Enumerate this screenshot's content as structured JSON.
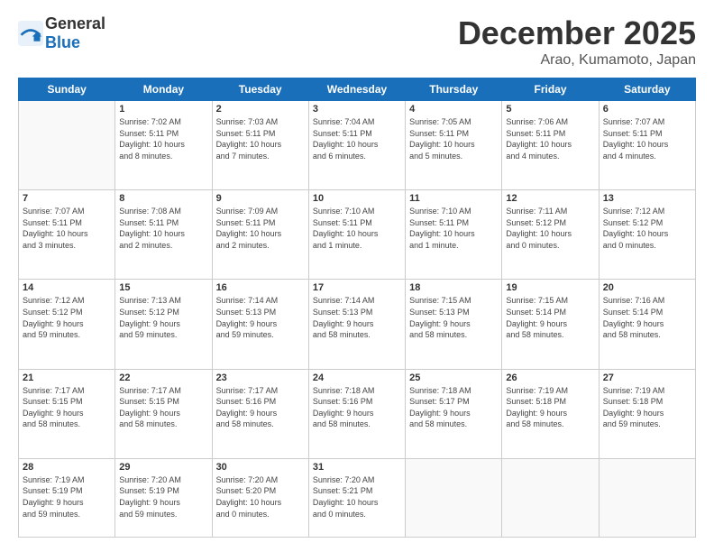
{
  "header": {
    "logo_general": "General",
    "logo_blue": "Blue",
    "month": "December 2025",
    "location": "Arao, Kumamoto, Japan"
  },
  "days_of_week": [
    "Sunday",
    "Monday",
    "Tuesday",
    "Wednesday",
    "Thursday",
    "Friday",
    "Saturday"
  ],
  "weeks": [
    [
      {
        "day": "",
        "info": ""
      },
      {
        "day": "1",
        "info": "Sunrise: 7:02 AM\nSunset: 5:11 PM\nDaylight: 10 hours\nand 8 minutes."
      },
      {
        "day": "2",
        "info": "Sunrise: 7:03 AM\nSunset: 5:11 PM\nDaylight: 10 hours\nand 7 minutes."
      },
      {
        "day": "3",
        "info": "Sunrise: 7:04 AM\nSunset: 5:11 PM\nDaylight: 10 hours\nand 6 minutes."
      },
      {
        "day": "4",
        "info": "Sunrise: 7:05 AM\nSunset: 5:11 PM\nDaylight: 10 hours\nand 5 minutes."
      },
      {
        "day": "5",
        "info": "Sunrise: 7:06 AM\nSunset: 5:11 PM\nDaylight: 10 hours\nand 4 minutes."
      },
      {
        "day": "6",
        "info": "Sunrise: 7:07 AM\nSunset: 5:11 PM\nDaylight: 10 hours\nand 4 minutes."
      }
    ],
    [
      {
        "day": "7",
        "info": "Sunrise: 7:07 AM\nSunset: 5:11 PM\nDaylight: 10 hours\nand 3 minutes."
      },
      {
        "day": "8",
        "info": "Sunrise: 7:08 AM\nSunset: 5:11 PM\nDaylight: 10 hours\nand 2 minutes."
      },
      {
        "day": "9",
        "info": "Sunrise: 7:09 AM\nSunset: 5:11 PM\nDaylight: 10 hours\nand 2 minutes."
      },
      {
        "day": "10",
        "info": "Sunrise: 7:10 AM\nSunset: 5:11 PM\nDaylight: 10 hours\nand 1 minute."
      },
      {
        "day": "11",
        "info": "Sunrise: 7:10 AM\nSunset: 5:11 PM\nDaylight: 10 hours\nand 1 minute."
      },
      {
        "day": "12",
        "info": "Sunrise: 7:11 AM\nSunset: 5:12 PM\nDaylight: 10 hours\nand 0 minutes."
      },
      {
        "day": "13",
        "info": "Sunrise: 7:12 AM\nSunset: 5:12 PM\nDaylight: 10 hours\nand 0 minutes."
      }
    ],
    [
      {
        "day": "14",
        "info": "Sunrise: 7:12 AM\nSunset: 5:12 PM\nDaylight: 9 hours\nand 59 minutes."
      },
      {
        "day": "15",
        "info": "Sunrise: 7:13 AM\nSunset: 5:12 PM\nDaylight: 9 hours\nand 59 minutes."
      },
      {
        "day": "16",
        "info": "Sunrise: 7:14 AM\nSunset: 5:13 PM\nDaylight: 9 hours\nand 59 minutes."
      },
      {
        "day": "17",
        "info": "Sunrise: 7:14 AM\nSunset: 5:13 PM\nDaylight: 9 hours\nand 58 minutes."
      },
      {
        "day": "18",
        "info": "Sunrise: 7:15 AM\nSunset: 5:13 PM\nDaylight: 9 hours\nand 58 minutes."
      },
      {
        "day": "19",
        "info": "Sunrise: 7:15 AM\nSunset: 5:14 PM\nDaylight: 9 hours\nand 58 minutes."
      },
      {
        "day": "20",
        "info": "Sunrise: 7:16 AM\nSunset: 5:14 PM\nDaylight: 9 hours\nand 58 minutes."
      }
    ],
    [
      {
        "day": "21",
        "info": "Sunrise: 7:17 AM\nSunset: 5:15 PM\nDaylight: 9 hours\nand 58 minutes."
      },
      {
        "day": "22",
        "info": "Sunrise: 7:17 AM\nSunset: 5:15 PM\nDaylight: 9 hours\nand 58 minutes."
      },
      {
        "day": "23",
        "info": "Sunrise: 7:17 AM\nSunset: 5:16 PM\nDaylight: 9 hours\nand 58 minutes."
      },
      {
        "day": "24",
        "info": "Sunrise: 7:18 AM\nSunset: 5:16 PM\nDaylight: 9 hours\nand 58 minutes."
      },
      {
        "day": "25",
        "info": "Sunrise: 7:18 AM\nSunset: 5:17 PM\nDaylight: 9 hours\nand 58 minutes."
      },
      {
        "day": "26",
        "info": "Sunrise: 7:19 AM\nSunset: 5:18 PM\nDaylight: 9 hours\nand 58 minutes."
      },
      {
        "day": "27",
        "info": "Sunrise: 7:19 AM\nSunset: 5:18 PM\nDaylight: 9 hours\nand 59 minutes."
      }
    ],
    [
      {
        "day": "28",
        "info": "Sunrise: 7:19 AM\nSunset: 5:19 PM\nDaylight: 9 hours\nand 59 minutes."
      },
      {
        "day": "29",
        "info": "Sunrise: 7:20 AM\nSunset: 5:19 PM\nDaylight: 9 hours\nand 59 minutes."
      },
      {
        "day": "30",
        "info": "Sunrise: 7:20 AM\nSunset: 5:20 PM\nDaylight: 10 hours\nand 0 minutes."
      },
      {
        "day": "31",
        "info": "Sunrise: 7:20 AM\nSunset: 5:21 PM\nDaylight: 10 hours\nand 0 minutes."
      },
      {
        "day": "",
        "info": ""
      },
      {
        "day": "",
        "info": ""
      },
      {
        "day": "",
        "info": ""
      }
    ]
  ]
}
